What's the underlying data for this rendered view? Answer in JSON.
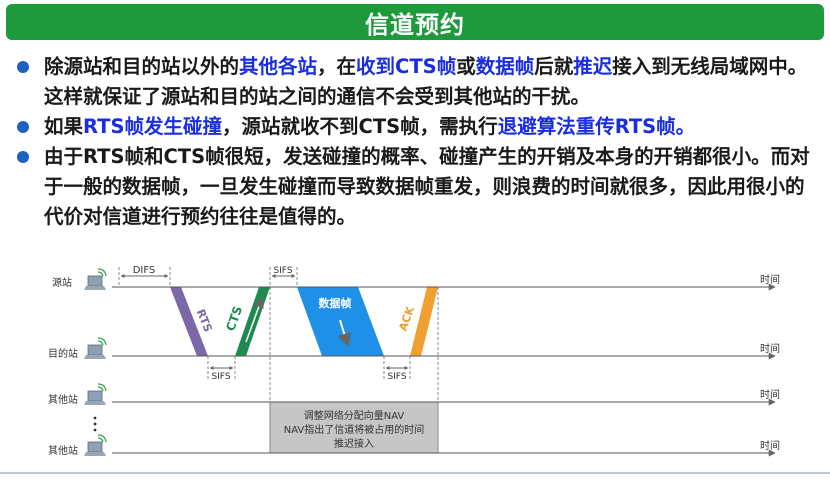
{
  "title": "信道预约",
  "bullets": [
    {
      "segments": [
        {
          "text": "除源站和目的站以外的",
          "hl": false
        },
        {
          "text": "其他各站",
          "hl": true
        },
        {
          "text": "，在",
          "hl": false
        },
        {
          "text": "收到CTS帧",
          "hl": true
        },
        {
          "text": "或",
          "hl": false
        },
        {
          "text": "数据帧",
          "hl": true
        },
        {
          "text": "后就",
          "hl": false
        },
        {
          "text": "推迟",
          "hl": true
        },
        {
          "text": "接入到无线局域网中。这样就保证了源站和目的站之间的通信不会受到其他站的干扰。",
          "hl": false
        }
      ]
    },
    {
      "segments": [
        {
          "text": "如果",
          "hl": false
        },
        {
          "text": "RTS帧发生碰撞",
          "hl": true
        },
        {
          "text": "，源站就收不到CTS帧，需执行",
          "hl": false
        },
        {
          "text": "退避算法重传RTS帧。",
          "hl": true
        }
      ]
    },
    {
      "segments": [
        {
          "text": "由于RTS帧和CTS帧很短，发送碰撞的概率、碰撞产生的开销及本身的开销都很小。而对于一般的数据帧，一旦发生碰撞而导致数据帧重发，则浪费的时间就很多，因此用很小的代价对信道进行预约往往是值得的。",
          "hl": false
        }
      ]
    }
  ],
  "diagram": {
    "stations": [
      "源站",
      "目的站",
      "其他站",
      "其他站"
    ],
    "time_label": "时间",
    "difs": "DIFS",
    "sifs": "SIFS",
    "frames": {
      "rts": "RTS",
      "cts": "CTS",
      "data": "数据帧",
      "ack": "ACK"
    },
    "nav_lines": [
      "调整网络分配向量NAV",
      "NAV指出了信道将被占用的时间",
      "推迟接入"
    ],
    "colors": {
      "title_bg": "#1e9a3c",
      "highlight": "#1a2ee0",
      "rts": "#7b68a8",
      "cts": "#1e8a50",
      "data": "#1e90e8",
      "ack": "#f0a030",
      "nav_box": "#c6c6c6"
    }
  }
}
